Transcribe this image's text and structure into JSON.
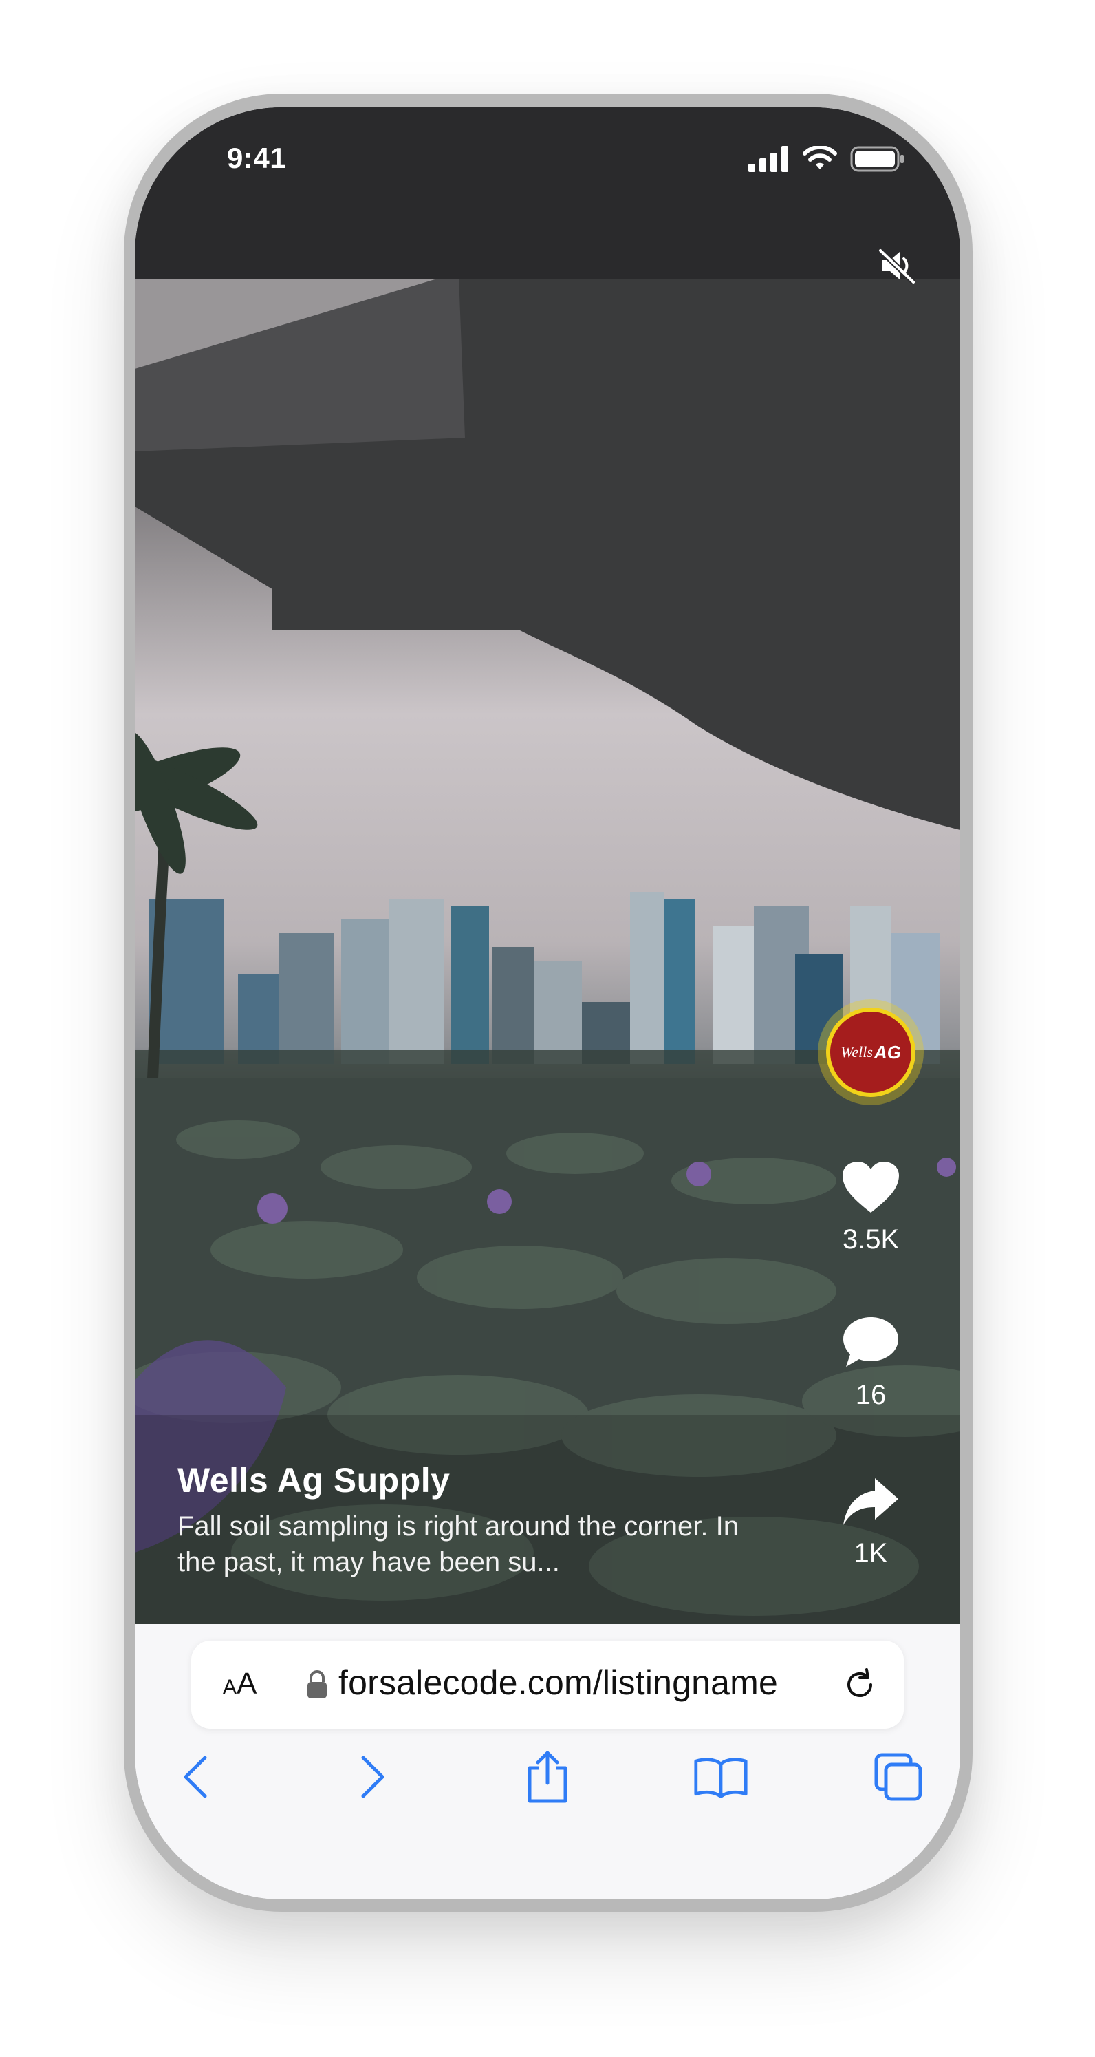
{
  "status": {
    "time": "9:41"
  },
  "post": {
    "account_name": "Wells Ag Supply",
    "description": "Fall soil sampling is right around the corner. In the past, it may have been su...",
    "avatar_text_1": "Wells",
    "avatar_text_2": "AG",
    "likes": "3.5K",
    "comments": "16",
    "shares": "1K"
  },
  "browser": {
    "text_size_label_small": "A",
    "text_size_label_large": "A",
    "url": "forsalecode.com/listingname"
  },
  "colors": {
    "accent_blue": "#2f7cf6",
    "avatar_red": "#a51d1d",
    "avatar_ring": "#f2d21a"
  }
}
